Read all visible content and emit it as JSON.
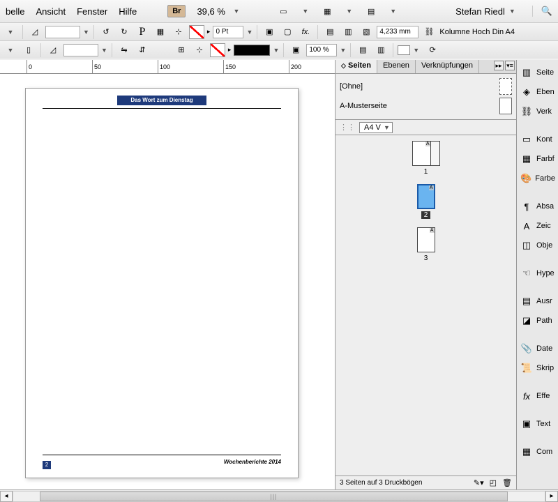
{
  "menu": {
    "tabelle": "belle",
    "ansicht": "Ansicht",
    "fenster": "Fenster",
    "hilfe": "Hilfe"
  },
  "br_label": "Br",
  "zoom": "39,6 %",
  "user": "Stefan Riedl",
  "toolbar": {
    "stroke_weight": "0 Pt",
    "opacity": "100 %",
    "measure": "4,233 mm",
    "kolumne": "Kolumne Hoch Din A4"
  },
  "ruler": {
    "t0": "0",
    "t50": "50",
    "t100": "100",
    "t150": "150",
    "t200": "200"
  },
  "page": {
    "title": "Das Wort zum Dienstag",
    "footer": "Wochenberichte 2014",
    "num": "2"
  },
  "panel": {
    "tabs": {
      "seiten": "Seiten",
      "ebenen": "Ebenen",
      "verkn": "Verknüpfungen"
    },
    "masters": {
      "none": "[Ohne]",
      "a": "A-Musterseite"
    },
    "size": "A4 V",
    "thumbs": {
      "p1": "1",
      "p2": "2",
      "p3": "3",
      "corner": "A"
    },
    "footer": "3 Seiten auf 3 Druckbögen"
  },
  "dock": {
    "seite": "Seite",
    "eben": "Eben",
    "verk": "Verk",
    "kont": "Kont",
    "farbf": "Farbf",
    "farbe": "Farbe",
    "absa": "Absa",
    "zeic": "Zeic",
    "obje": "Obje",
    "hype": "Hype",
    "ausr": "Ausr",
    "path": "Path",
    "date": "Date",
    "skrip": "Skrip",
    "effe": "Effe",
    "text": "Text",
    "com": "Com"
  }
}
